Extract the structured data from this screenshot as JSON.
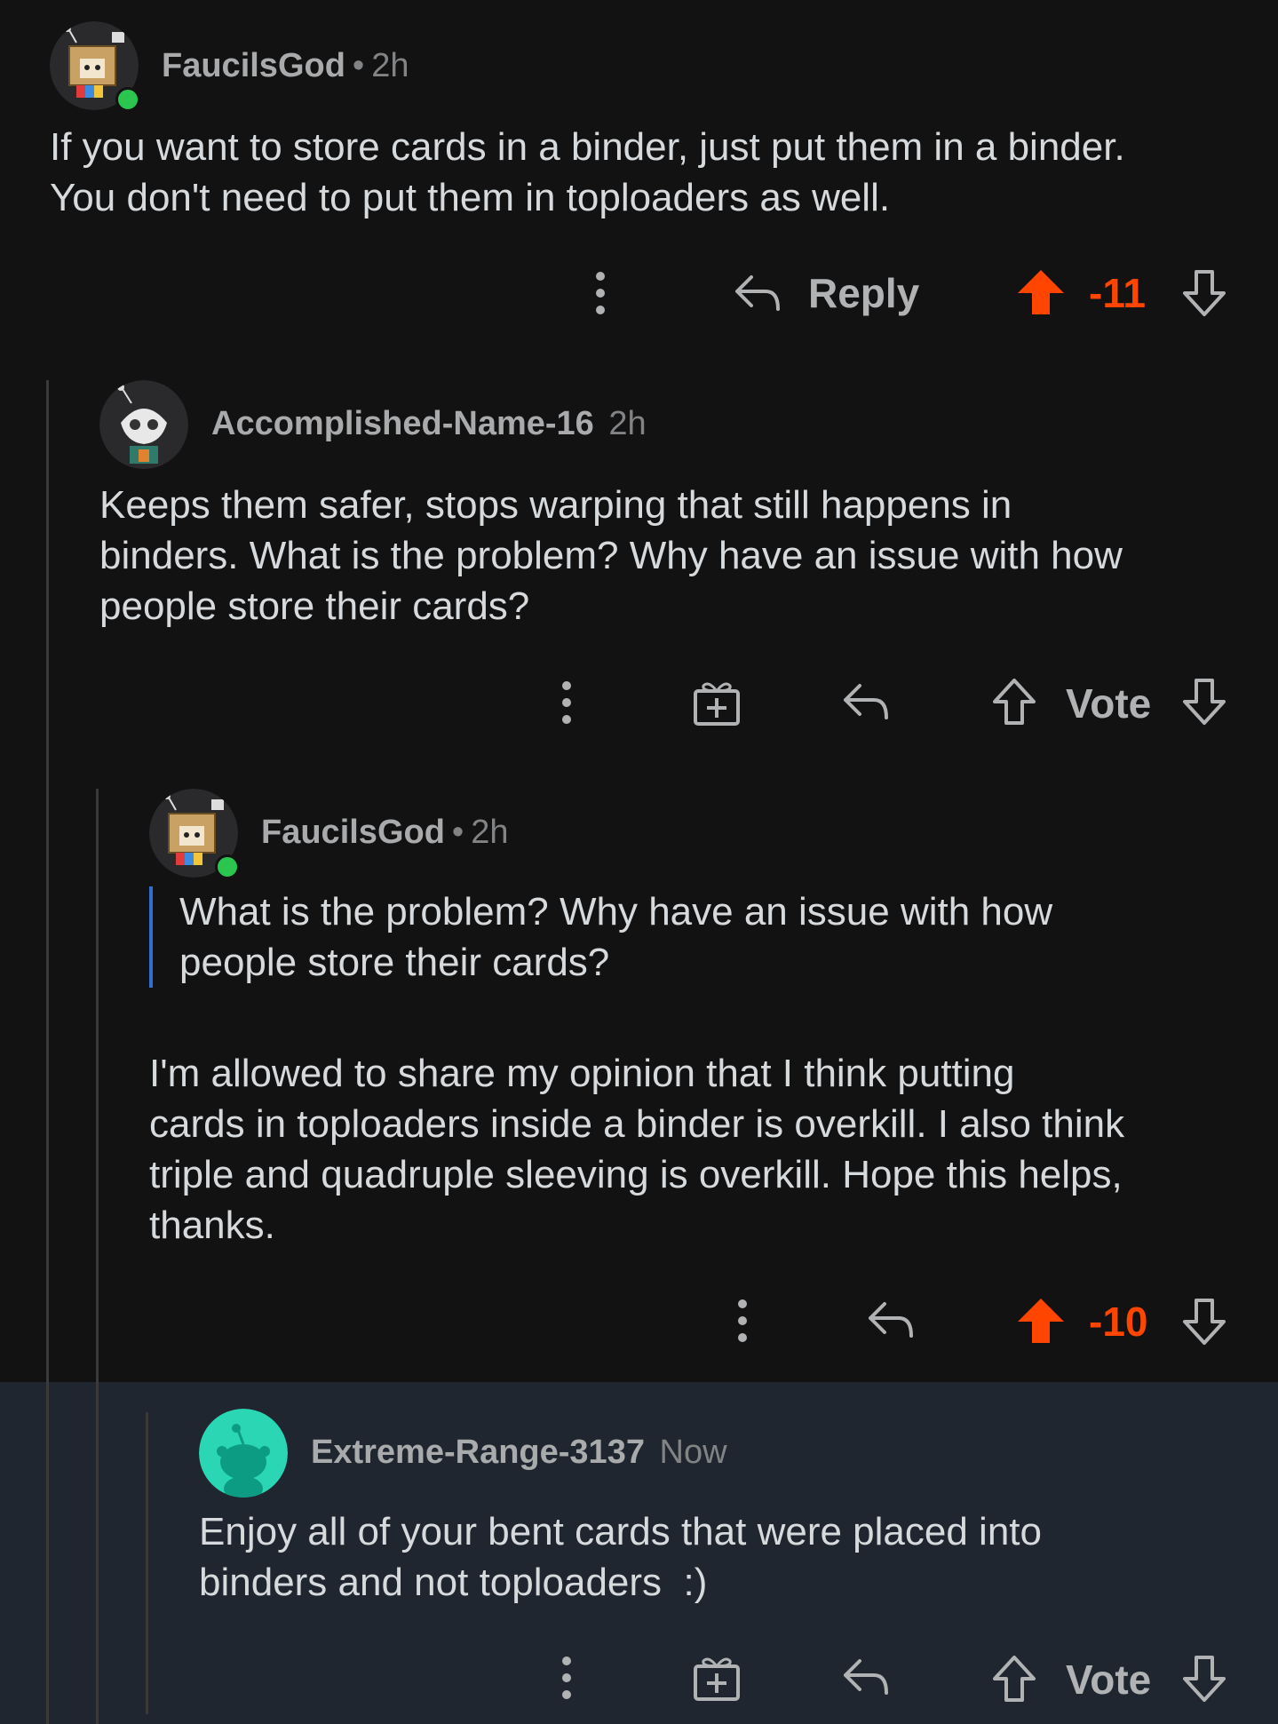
{
  "colors": {
    "background": "#121213",
    "highlight_background": "#1f2630",
    "upvote_active": "#ff4500",
    "online": "#2bc650",
    "quote_bar": "#2f6fd4"
  },
  "comments": [
    {
      "username": "FaucilsGod",
      "separator": "•",
      "time": "2h",
      "avatar_icon": "snoo-cardboard-box-avatar",
      "lines": [
        "If you want to store cards in a binder, just put them in a binder.",
        "You don't need to put them in toploaders as well."
      ],
      "actions": {
        "more_icon": "more-vertical-icon",
        "reply_label": "Reply",
        "score": "-11",
        "upvoted": true
      }
    },
    {
      "username": "Accomplished-Name-16",
      "time": "2h",
      "avatar_icon": "snoo-skull-avatar",
      "lines": [
        "Keeps them safer, stops warping that still happens in",
        "binders. What is the problem? Why have an issue with how",
        "people store their cards?"
      ],
      "actions": {
        "more_icon": "more-vertical-icon",
        "award_icon": "gift-icon",
        "vote_label": "Vote",
        "upvoted": false
      }
    },
    {
      "username": "FaucilsGod",
      "separator": "•",
      "time": "2h",
      "avatar_icon": "snoo-cardboard-box-avatar",
      "quote_lines": [
        "What is the problem? Why have an issue with how",
        "people store their cards?"
      ],
      "lines": [
        "I'm allowed to share my opinion that I think putting",
        "cards in toploaders inside a binder is overkill. I also think",
        "triple and quadruple sleeving is overkill. Hope this helps,",
        "thanks."
      ],
      "actions": {
        "more_icon": "more-vertical-icon",
        "score": "-10",
        "upvoted": true
      }
    },
    {
      "username": "Extreme-Range-3137",
      "time": "Now",
      "avatar_icon": "default-snoo-avatar",
      "lines": [
        "Enjoy all of your bent cards that were placed into",
        "binders and not toploaders  :)"
      ],
      "actions": {
        "more_icon": "more-vertical-icon",
        "award_icon": "gift-icon",
        "vote_label": "Vote",
        "upvoted": false
      }
    }
  ]
}
